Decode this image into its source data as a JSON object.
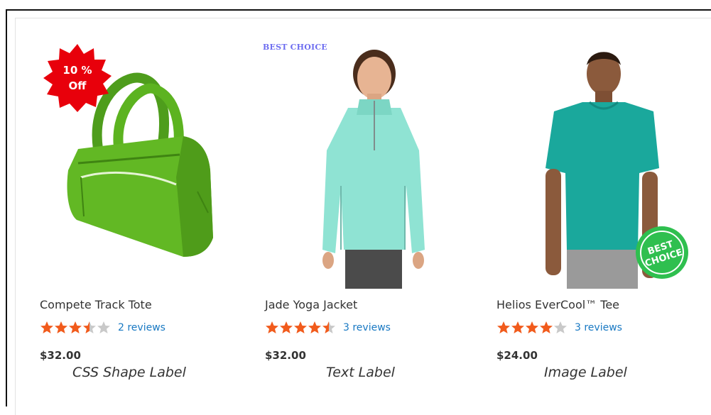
{
  "products": [
    {
      "name": "Compete Track Tote",
      "rating": 3.5,
      "reviews": "2 reviews",
      "price": "$32.00",
      "label_type": "CSS Shape Label",
      "badge": {
        "line1": "10 %",
        "line2": "Off",
        "color": "#e8000b"
      }
    },
    {
      "name": "Jade Yoga Jacket",
      "rating": 4.5,
      "reviews": "3 reviews",
      "price": "$32.00",
      "label_type": "Text Label",
      "badge": {
        "text": "BEST CHOICE",
        "color": "#6d6df0"
      }
    },
    {
      "name": "Helios EverCool™ Tee",
      "rating": 4,
      "reviews": "3 reviews",
      "price": "$24.00",
      "label_type": "Image Label",
      "badge": {
        "line1": "BEST",
        "line2": "CHOICE",
        "color": "#2fbf4f"
      }
    }
  ],
  "colors": {
    "star_on": "#f15b1c",
    "star_off": "#c9c9c9",
    "link": "#1979c3"
  }
}
